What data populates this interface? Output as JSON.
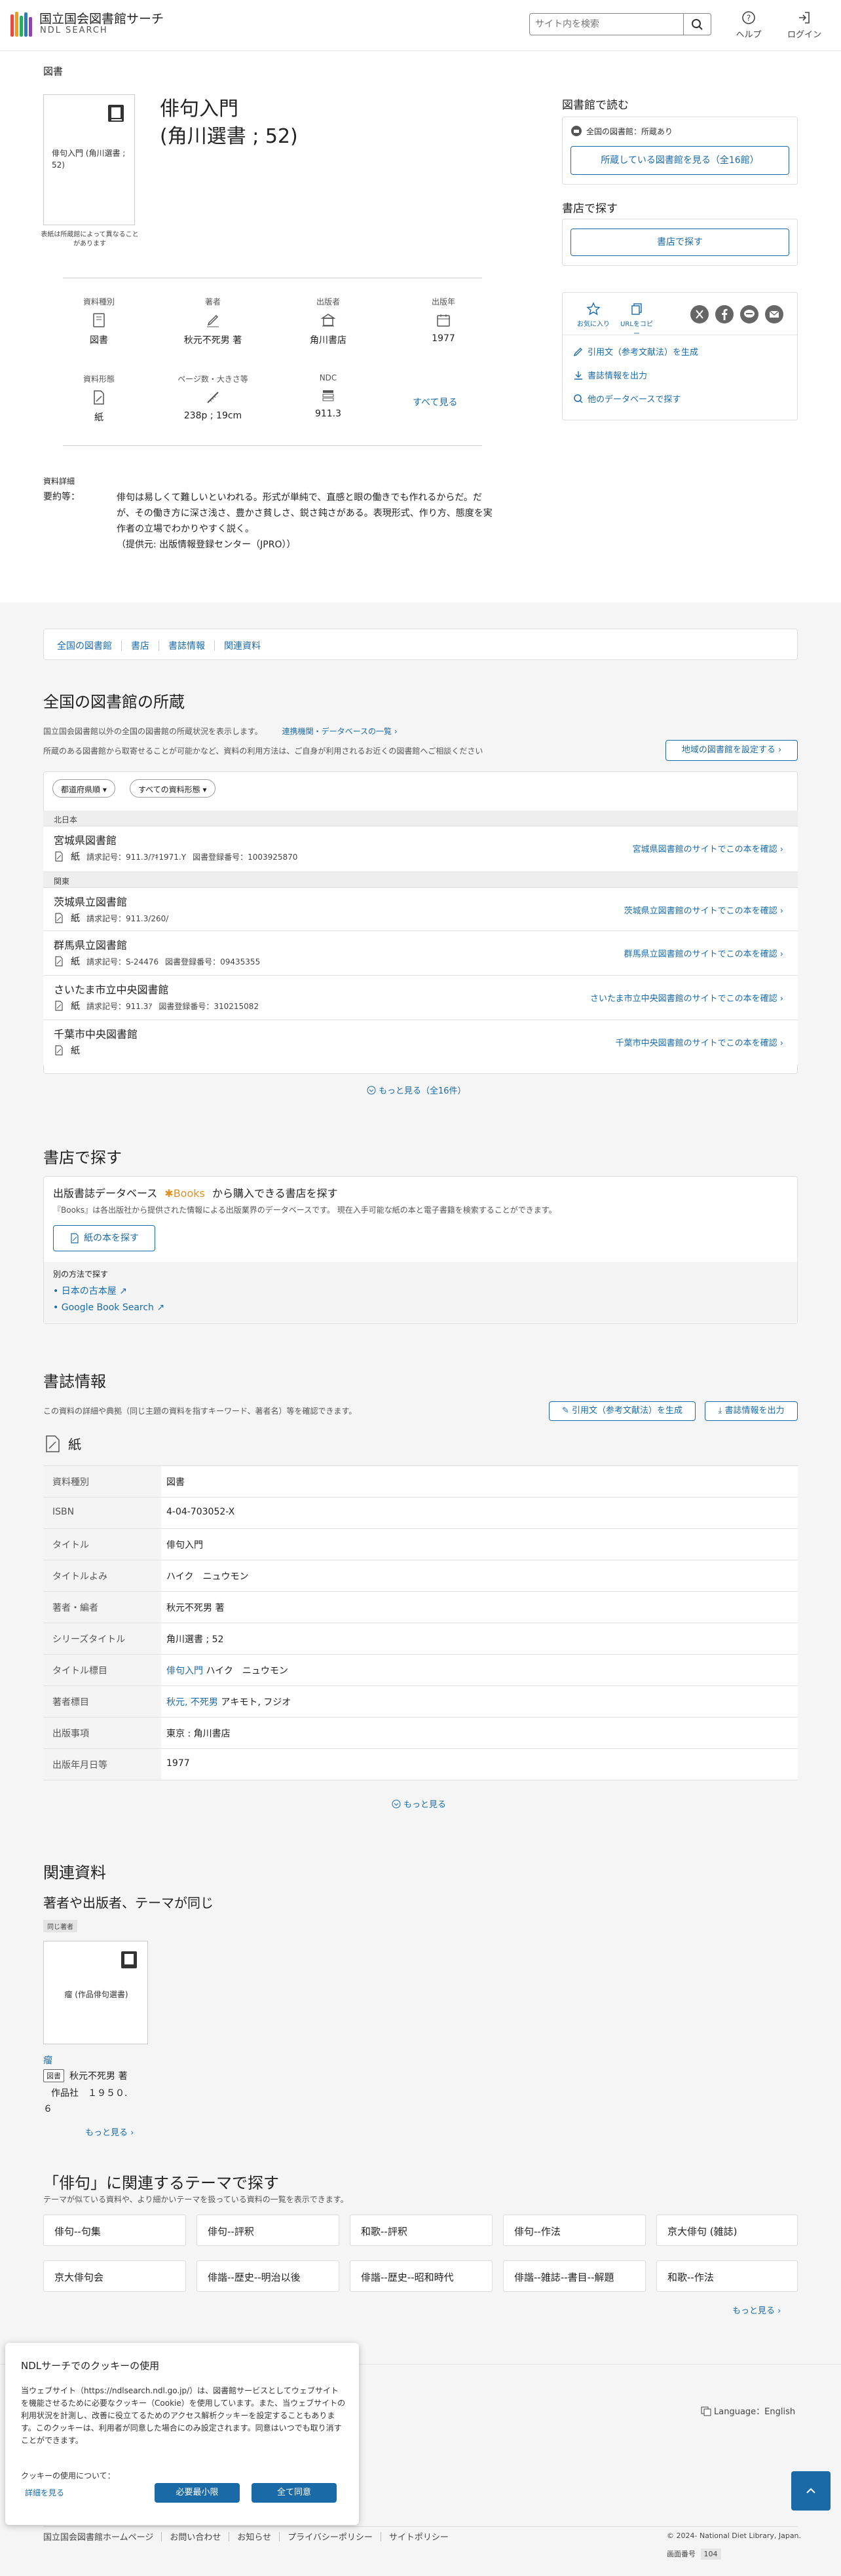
{
  "header": {
    "logo_ja": "国立国会図書館サーチ",
    "logo_en": "NDL SEARCH",
    "search_placeholder": "サイト内を検索",
    "help": "ヘルプ",
    "login": "ログイン"
  },
  "page": {
    "category": "図書"
  },
  "book": {
    "title_line1": "俳句入門",
    "title_line2": "(角川選書 ; 52)",
    "thumb_text": "俳句入門 (角川選書 ; 52)",
    "thumb_note": "表紙は所蔵館によって異なることがあります"
  },
  "meta": [
    {
      "label": "資料種別",
      "value": "図書",
      "icon": "book-icon"
    },
    {
      "label": "著者",
      "value": "秋元不死男 著",
      "icon": "pen-icon"
    },
    {
      "label": "出版者",
      "value": "角川書店",
      "icon": "building-icon"
    },
    {
      "label": "出版年",
      "value": "1977",
      "icon": "calendar-icon"
    },
    {
      "label": "資料形態",
      "value": "紙",
      "icon": "paper-icon"
    },
    {
      "label": "ページ数・大きさ等",
      "value": "238p ; 19cm",
      "icon": "ruler-icon"
    },
    {
      "label": "NDC",
      "value": "911.3",
      "icon": "ndc-icon"
    }
  ],
  "meta_more": "すべて見る",
  "details": {
    "heading": "資料詳細",
    "summary_label": "要約等：",
    "summary": "俳句は易しくて難しいといわれる。形式が単純で、直感と眼の働きでも作れるからだ。だが、その働き方に深さ浅さ、豊かさ貧しさ、鋭さ鈍さがある。表現形式、作り方、態度を実作者の立場でわかりやすく説く。",
    "source": "（提供元: 出版情報登録センター（JPRO））"
  },
  "sidebar": {
    "read_title": "図書館で読む",
    "ndl_status": "全国の図書館：所蔵あり",
    "ndl_btn": "所蔵している図書館を見る（全16館）",
    "shop_title": "書店で探す",
    "shop_btn": "書店で探す",
    "fav": "お気に入り",
    "copy_url": "URLをコピー",
    "cite": "引用文（参考文献法）を生成",
    "export": "書誌情報を出力",
    "other_db": "他のデータベースで探す"
  },
  "tabs": [
    "全国の図書館",
    "書店",
    "書誌情報",
    "関連資料"
  ],
  "holdings": {
    "title": "全国の図書館の所蔵",
    "desc1": "国立国会図書館以外の全国の図書館の所蔵状況を表示します。",
    "desc_link": "連携機関・データベースの一覧",
    "desc2": "所蔵のある図書館から取寄せることが可能かなど、資料の利用方法は、ご自身が利用されるお近くの図書館へご相談ください",
    "region_btn": "地域の図書館を設定する",
    "filter_pref": "都道府県順",
    "filter_type": "すべての資料形態",
    "region_north": "北日本",
    "region_kanto": "関東",
    "libs": [
      {
        "name": "宮城県図書館",
        "form": "紙",
        "call": "請求記号：911.3/ｱｷ1971.Y",
        "reg": "図書登録番号：1003925870",
        "link": "宮城県図書館のサイトでこの本を確認"
      },
      {
        "name": "茨城県立図書館",
        "form": "紙",
        "call": "請求記号：911.3/260/",
        "reg": "",
        "link": "茨城県立図書館のサイトでこの本を確認"
      },
      {
        "name": "群馬県立図書館",
        "form": "紙",
        "call": "請求記号：S-24476",
        "reg": "図書登録番号：09435355",
        "link": "群馬県立図書館のサイトでこの本を確認"
      },
      {
        "name": "さいたま市立中央図書館",
        "form": "紙",
        "call": "請求記号：911.3ｱ",
        "reg": "図書登録番号：310215082",
        "link": "さいたま市立中央図書館のサイトでこの本を確認"
      },
      {
        "name": "千葉市中央図書館",
        "form": "紙",
        "call": "",
        "reg": "",
        "link": "千葉市中央図書館のサイトでこの本を確認"
      }
    ],
    "more": "もっと見る（全16件）"
  },
  "store": {
    "title": "書店で探す",
    "db_prefix": "出版書誌データベース",
    "db_brand": "Books",
    "db_suffix": "から購入できる書店を探す",
    "db_desc": "『Books』は各出版社から提供された情報による出版業界のデータベースです。 現在入手可能な紙の本と電子書籍を検索することができます。",
    "btn": "紙の本を探す",
    "other_title": "別の方法で探す",
    "other1": "日本の古本屋",
    "other2": "Google Book Search"
  },
  "biblio": {
    "title": "書誌情報",
    "desc": "この資料の詳細や典拠（同じ主題の資料を指すキーワード、著者名）等を確認できます。",
    "cite_btn": "引用文（参考文献法）を生成",
    "export_btn": "書誌情報を出力",
    "form": "紙",
    "rows": [
      {
        "k": "資料種別",
        "v": "図書",
        "link": false
      },
      {
        "k": "ISBN",
        "v": "4-04-703052-X",
        "link": false
      },
      {
        "k": "タイトル",
        "v": "俳句入門",
        "link": true
      },
      {
        "k": "タイトルよみ",
        "v": "ハイク　ニュウモン",
        "link": false
      },
      {
        "k": "著者・編者",
        "v": "秋元不死男 著",
        "link": false
      },
      {
        "k": "シリーズタイトル",
        "v": "角川選書 ; 52",
        "link": true
      },
      {
        "k": "タイトル標目",
        "v": "俳句入門",
        "v2": " ハイク　ニュウモン",
        "link": true
      },
      {
        "k": "著者標目",
        "v": "秋元, 不死男",
        "v2": " アキモト, フジオ",
        "link": true
      },
      {
        "k": "出版事項",
        "v": "東京 : 角川書店",
        "link": true
      },
      {
        "k": "出版年月日等",
        "v": "1977",
        "link": false
      }
    ],
    "more": "もっと見る"
  },
  "related": {
    "title": "関連資料",
    "sub": "著者や出版者、テーマが同じ",
    "same_author": "同じ著者",
    "card_thumb": "瘤 (作品俳句選書)",
    "card_title": "瘤",
    "card_type": "図書",
    "card_author": "秋元不死男 著",
    "card_pub_line1": "作品社　１９５０.",
    "card_pub_line2": "６",
    "more": "もっと見る"
  },
  "theme": {
    "title": "「俳句」に関連するテーマで探す",
    "desc": "テーマが似ている資料や、より細かいテーマを扱っている資料の一覧を表示できます。",
    "items": [
      "俳句--句集",
      "俳句--評釈",
      "和歌--評釈",
      "俳句--作法",
      "京大俳句 (雑誌)",
      "京大俳句会",
      "俳諧--歴史--明治以後",
      "俳諧--歴史--昭和時代",
      "俳諧--雑誌--書目--解題",
      "和歌--作法"
    ],
    "more": "もっと見る"
  },
  "cookie": {
    "title": "NDLサーチでのクッキーの使用",
    "body": "当ウェブサイト（https://ndlsearch.ndl.go.jp/）は、図書館サービスとしてウェブサイトを機能させるために必要なクッキー（Cookie）を使用しています。また、当ウェブサイトの利用状況を計測し、改善に役立てるためのアクセス解析クッキーを設定することもあります。このクッキーは、利用者が同意した場合にのみ設定されます。同意はいつでも取り消すことができます。",
    "about": "クッキーの使用について：",
    "detail": "詳細を見る",
    "min_btn": "必要最小限",
    "all_btn": "全て同意"
  },
  "footer": {
    "language": "Language：English",
    "links": [
      "国立国会図書館ホームページ",
      "お問い合わせ",
      "お知らせ",
      "プライバシーポリシー",
      "サイトポリシー"
    ],
    "copyright": "© 2024- National Diet Library, Japan.",
    "id_label": "画面番号",
    "id_value": "104"
  }
}
